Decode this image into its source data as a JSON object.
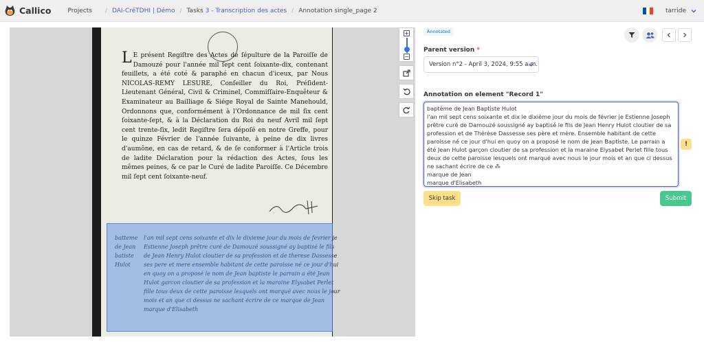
{
  "app": {
    "name": "Callico"
  },
  "nav": {
    "projects_label": "Projects",
    "breadcrumb": {
      "project": "DAI-CréTDHI | Démo",
      "tasks_prefix": "Tasks",
      "tasks_link": "3 - Transcription des actes",
      "current": "Annotation single_page 2"
    },
    "user": "tarride",
    "flag_colors": [
      "#0055a4",
      "#ffffff",
      "#ef4135"
    ]
  },
  "document": {
    "printed_dropcap": "L",
    "printed_text": "E présent Regiſtre des Actes de ſépulture de la Paroiſſe de Damouzé pour l'année mil ſept cent ſoixante-dix, contenant feuillets, a été coté & paraphé en chacun d'iceux, par Nous NICOLAS-REMY LESURE, Conſeiller du Roi, Préſident-Lieutenant Général, Civil & Criminel, Commiſſaire-Enquêteur & Examinateur au Bailliage & Siége Royal de Sainte Manehould, Ordonnons que, conformément à l'Ordonnance de mil ſix cent ſoixante-ſept, & à la Déclaration du Roi du neuf Avril mil ſept cent trente-ſix, ledit Regiſtre ſera dépoſé en notre Greffe, pour le quinze Février de l'année ſuivante, à peine de dix livres d'aumône, en cas de retard, & de ſe conformer à l'Article trois de ladite Déclaration pour la rédaction des Actes, ſous les mêmes peines, & ce par le Curé de ladite Paroiſſe. Ce Décembre mil ſept cent ſoixante-neuf.",
    "hand_margin": "batteme de Jean batiste Hulot",
    "hand_body": "l'an mil sept cens soixante et dix le dixieme jour du mois de fevrier je Estienne Joseph prêtre curé de Damouzé soussigné ay baptisé le fils de Jean Henry Hulot cloutier de sa profession et de therese Dassesse ses pere et mere ensemble habitant de cette paroisse né ce jour d'hui en quoy on a proposé le nom de Jean baptiste le parrain a été Jean Hulot garcon cloutier de sa profession et la maraine Elysabet Perlet fille tous deux de cette paroisse lesquels ont marqué avec nous le jour mois et an que ci dessus ne sachant écrire de ce marque de Jean marque d'Elisabeth"
  },
  "viewer": {
    "zoom_in": "+",
    "zoom_out": "−",
    "highlight_color": "#4b85e6"
  },
  "panel": {
    "status_tag": "Annotated",
    "parent_version_label": "Parent version",
    "required_mark": "*",
    "parent_version_value": "Version n°2 - April 3, 2024, 9:55 a.m.",
    "annotation_label": "Annotation on element \"Record 1\"",
    "annotation_text": "baptème de Jean Baptiste Hulot\nl'an mil sept cens soixante et dix le dixième jour du mois de février je Estienne Joseph prêtre curé de Damouzé soussigné ay baptisé le fils de Jean Henry Hulot cloutier de sa profession et de Thérèse Dassesse ses père et mère. Ensemble habitant de cette paroisse né ce jour d'hui en quoy on a proposé le nom de Jean Baptiste. Le parrain a été Jean Hulot garçon cloutier de sa profession et la maraine Elysabet Perlet fille tous deux de cette paroisse lesquels ont marqué avec nous le jour mois et an que ci dessus ne sachant écrire de ce ⁂\nmarque de Jean\nmarque d'Elisabeth",
    "warning_glyph": "!",
    "skip_label": "Skip task",
    "submit_label": "Submit"
  }
}
